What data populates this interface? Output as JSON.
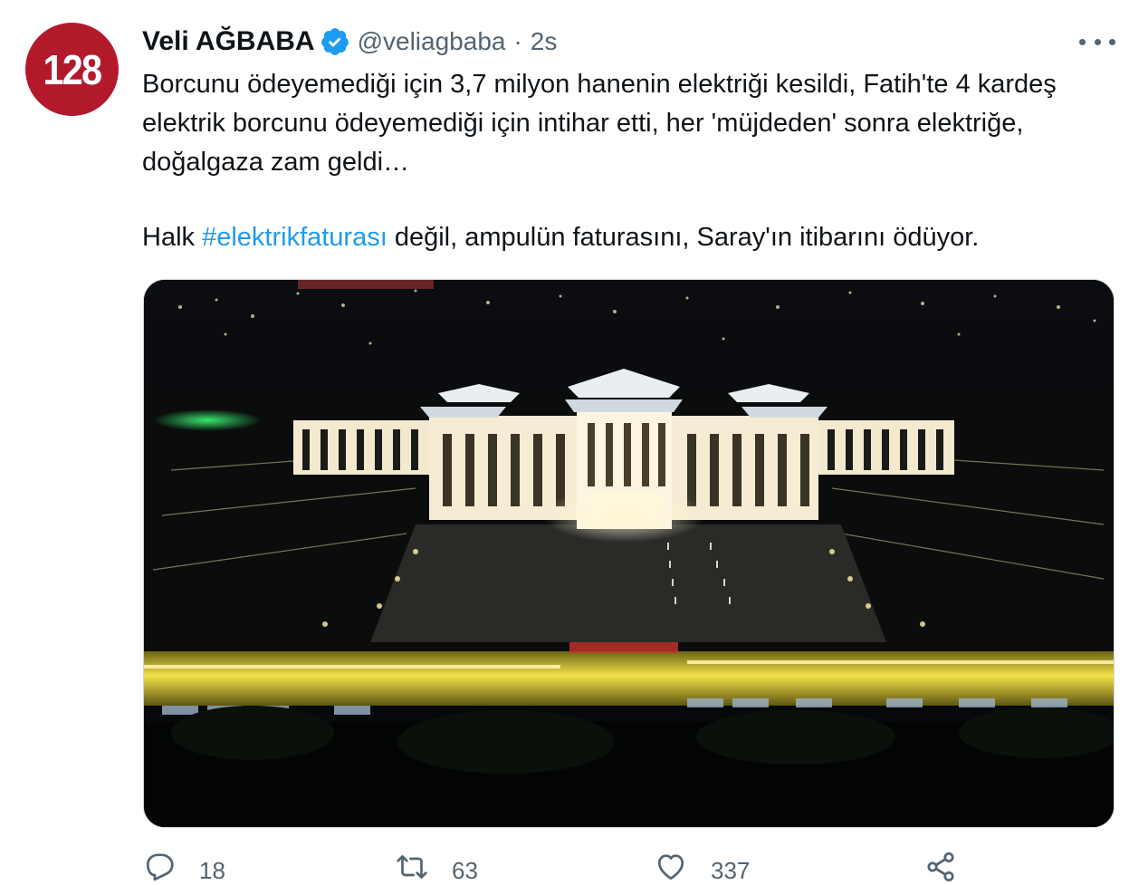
{
  "tweet": {
    "avatar_text": "128",
    "author_name": "Veli AĞBABA",
    "handle": "@veliagbaba",
    "separator": "·",
    "time": "2s",
    "text_line1": "Borcunu ödeyemediği için 3,7 milyon hanenin elektriği kesildi, Fatih'te 4 kardeş elektrik borcunu ödeyemediği için intihar etti, her 'müjdeden' sonra elektriğe, doğalgaza zam geldi…",
    "text_p2_before": "Halk ",
    "hashtag": "#elektrikfaturası",
    "text_p2_after": " değil, ampulün faturasını, Saray'ın itibarını ödüyor."
  },
  "actions": {
    "reply_count": "18",
    "retweet_count": "63",
    "like_count": "337"
  },
  "icons": {
    "verified": "verified-badge-icon",
    "more": "more-options-icon",
    "reply": "reply-icon",
    "retweet": "retweet-icon",
    "like": "heart-icon",
    "share": "share-icon"
  },
  "colors": {
    "link": "#1d9bf0",
    "secondary_text": "#536471",
    "avatar_bg": "#b21a2c"
  }
}
